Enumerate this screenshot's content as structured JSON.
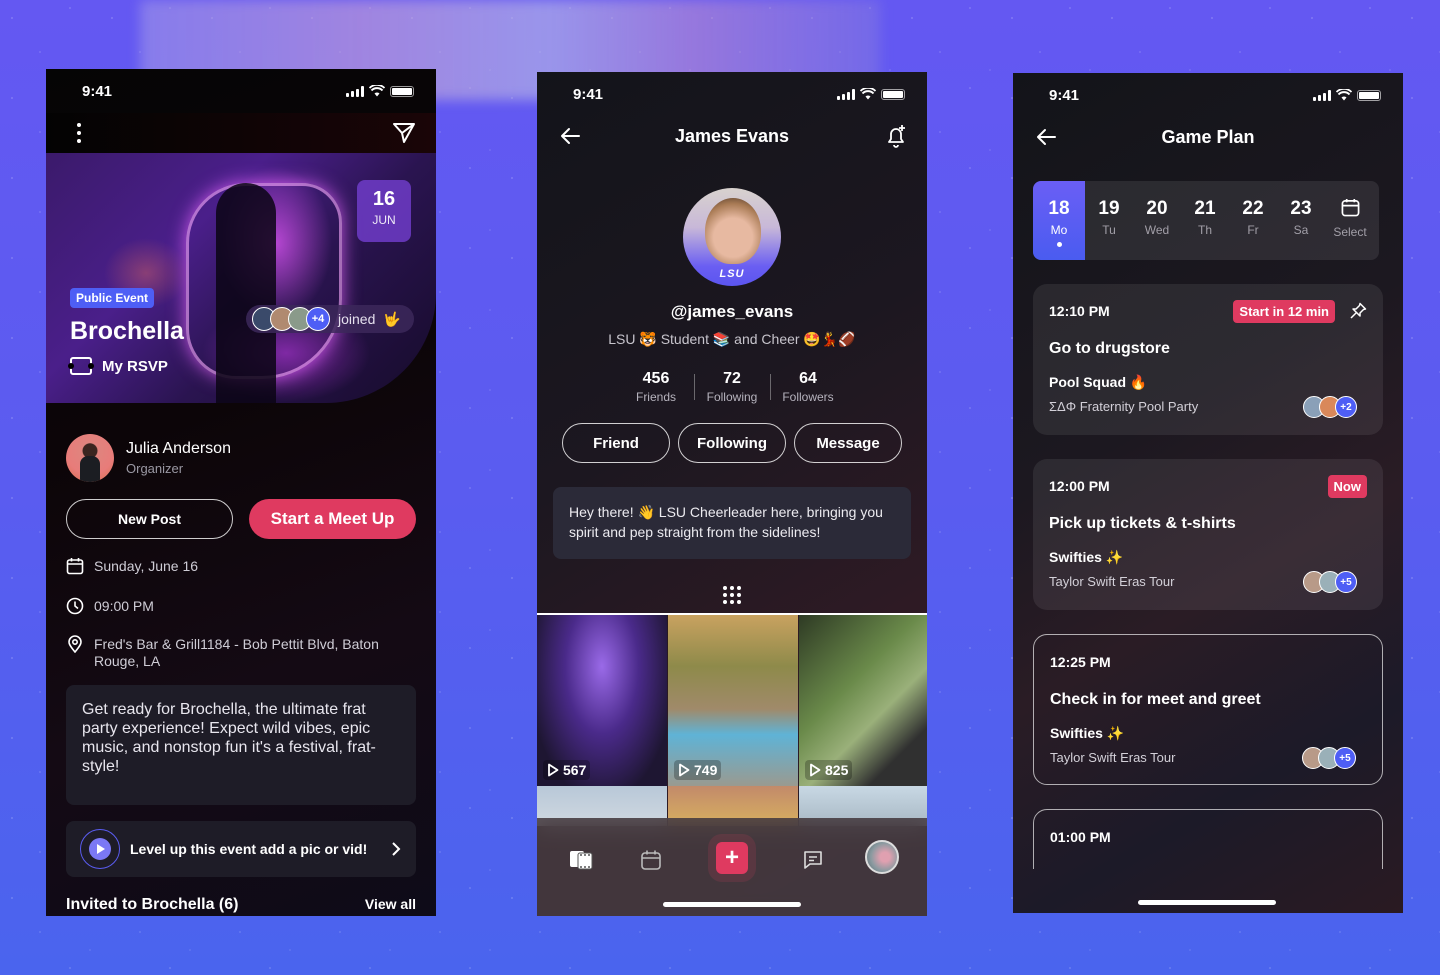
{
  "status_time": "9:41",
  "colors": {
    "accent_pink": "#df3a60",
    "accent_blue": "#4e5ef5",
    "bg_purple": "#5a5cf0"
  },
  "event_screen": {
    "menu_icon": "kebab-icon",
    "share_icon": "send-icon",
    "date_badge": {
      "day": "16",
      "month": "JUN"
    },
    "public_badge": "Public Event",
    "title": "Brochella",
    "rsvp_label": "My RSVP",
    "joined": {
      "extra_count": "+4",
      "label": "joined",
      "emoji": "🤟"
    },
    "organizer": {
      "name": "Julia Anderson",
      "role": "Organizer"
    },
    "buttons": {
      "new_post": "New Post",
      "meet_up": "Start a Meet Up"
    },
    "date_text": "Sunday, June 16",
    "time_text": "09:00 PM",
    "location_text": "Fred's Bar & Grill1184 - Bob Pettit Blvd, Baton Rouge, LA",
    "description": "Get ready for Brochella, the ultimate frat party experience! Expect wild vibes, epic music, and nonstop fun it's a festival, frat-style!",
    "level_up_text": "Level up this event add a pic or vid!",
    "invited_title": "Invited to Brochella (6)",
    "view_all": "View all"
  },
  "profile_screen": {
    "title": "James Evans",
    "avatar_text": "LSU",
    "handle": "@james_evans",
    "bio": "LSU 🐯 Student 📚 and Cheer 🤩💃🏈",
    "stats": [
      {
        "value": "456",
        "label": "Friends"
      },
      {
        "value": "72",
        "label": "Following"
      },
      {
        "value": "64",
        "label": "Followers"
      }
    ],
    "buttons": [
      "Friend",
      "Following",
      "Message"
    ],
    "about": "Hey there! 👋 LSU Cheerleader here, bringing you spirit and pep straight from the sidelines!",
    "media": [
      {
        "views": "567"
      },
      {
        "views": "749"
      },
      {
        "views": "825"
      }
    ],
    "tabbar": [
      "reels-icon",
      "calendar-icon",
      "plus-icon",
      "chat-icon",
      "profile-avatar"
    ]
  },
  "gameplan_screen": {
    "title": "Game Plan",
    "days": [
      {
        "num": "18",
        "wd": "Mo",
        "selected": true
      },
      {
        "num": "19",
        "wd": "Tu"
      },
      {
        "num": "20",
        "wd": "Wed"
      },
      {
        "num": "21",
        "wd": "Th"
      },
      {
        "num": "22",
        "wd": "Fr"
      },
      {
        "num": "23",
        "wd": "Sa"
      }
    ],
    "select_label": "Select",
    "events": [
      {
        "time": "12:10 PM",
        "tag": "Start in 12 min",
        "title": "Go to drugstore",
        "group": "Pool Squad 🔥",
        "subtitle": "ΣΔΦ Fraternity Pool Party",
        "extra": "+2",
        "pinned": true
      },
      {
        "time": "12:00 PM",
        "tag": "Now",
        "title": "Pick up tickets & t-shirts",
        "group": "Swifties ✨",
        "subtitle": "Taylor Swift Eras Tour",
        "extra": "+5"
      },
      {
        "time": "12:25 PM",
        "title": "Check in for meet and greet",
        "group": "Swifties ✨",
        "subtitle": "Taylor Swift Eras Tour",
        "extra": "+5"
      },
      {
        "time": "01:00 PM"
      }
    ]
  }
}
